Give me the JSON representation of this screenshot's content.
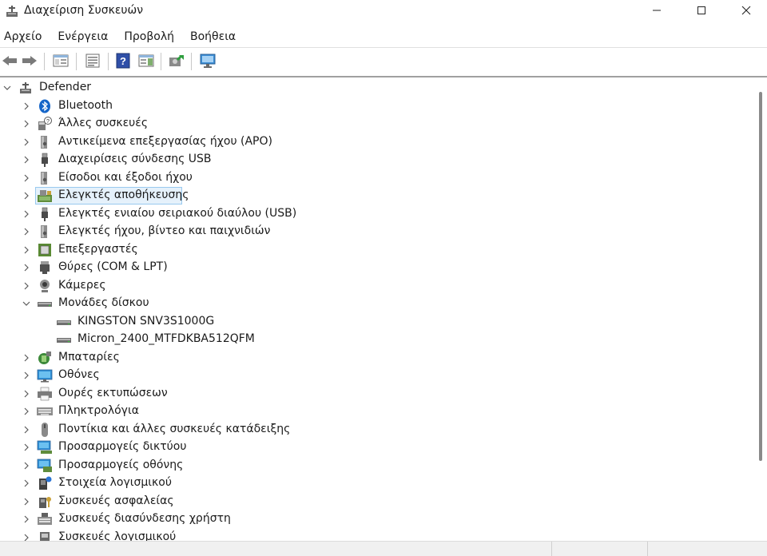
{
  "window": {
    "title": "Διαχείριση Συσκευών",
    "app_icon": "device-manager-icon"
  },
  "menu": [
    {
      "label": "Αρχείο"
    },
    {
      "label": "Ενέργεια"
    },
    {
      "label": "Προβολή"
    },
    {
      "label": "Βοήθεια"
    }
  ],
  "toolbar": {
    "buttons": [
      "back-arrow-icon",
      "forward-arrow-icon",
      "show-hide-console-tree-icon",
      "properties-icon",
      "help-icon",
      "action-pane-icon",
      "update-driver-icon",
      "scan-hardware-icon"
    ]
  },
  "tree": {
    "root": {
      "label": "Defender",
      "icon": "computer-icon",
      "expanded": true
    },
    "items": [
      {
        "label": "Bluetooth",
        "icon": "bluetooth-icon",
        "expanded": false,
        "level": 1
      },
      {
        "label": "Άλλες συσκευές",
        "icon": "unknown-device-icon",
        "expanded": false,
        "level": 1
      },
      {
        "label": "Αντικείμενα επεξεργασίας ήχου (APO)",
        "icon": "speaker-icon",
        "expanded": false,
        "level": 1
      },
      {
        "label": "Διαχειρίσεις σύνδεσης USB",
        "icon": "usb-plug-icon",
        "expanded": false,
        "level": 1
      },
      {
        "label": "Είσοδοι και έξοδοι ήχου",
        "icon": "speaker-icon",
        "expanded": false,
        "level": 1
      },
      {
        "label": "Ελεγκτές αποθήκευσης",
        "icon": "storage-controller-icon",
        "expanded": false,
        "level": 1,
        "selected": true
      },
      {
        "label": "Ελεγκτές ενιαίου σειριακού διαύλου (USB)",
        "icon": "usb-plug-icon",
        "expanded": false,
        "level": 1
      },
      {
        "label": "Ελεγκτές ήχου, βίντεο και παιχνιδιών",
        "icon": "speaker-icon",
        "expanded": false,
        "level": 1
      },
      {
        "label": "Επεξεργαστές",
        "icon": "processor-icon",
        "expanded": false,
        "level": 1
      },
      {
        "label": "Θύρες (COM & LPT)",
        "icon": "port-icon",
        "expanded": false,
        "level": 1
      },
      {
        "label": "Κάμερες",
        "icon": "webcam-icon",
        "expanded": false,
        "level": 1
      },
      {
        "label": "Μονάδες δίσκου",
        "icon": "disk-drive-icon",
        "expanded": true,
        "level": 1
      },
      {
        "label": "KINGSTON SNV3S1000G",
        "icon": "disk-drive-icon",
        "level": 2
      },
      {
        "label": "Micron_2400_MTFDKBA512QFM",
        "icon": "disk-drive-icon",
        "level": 2
      },
      {
        "label": "Μπαταρίες",
        "icon": "battery-icon",
        "expanded": false,
        "level": 1
      },
      {
        "label": "Οθόνες",
        "icon": "monitor-icon",
        "expanded": false,
        "level": 1
      },
      {
        "label": "Ουρές εκτυπώσεων",
        "icon": "printer-icon",
        "expanded": false,
        "level": 1
      },
      {
        "label": "Πληκτρολόγια",
        "icon": "keyboard-icon",
        "expanded": false,
        "level": 1
      },
      {
        "label": "Ποντίκια και άλλες συσκευές κατάδειξης",
        "icon": "mouse-icon",
        "expanded": false,
        "level": 1
      },
      {
        "label": "Προσαρμογείς δικτύου",
        "icon": "network-adapter-icon",
        "expanded": false,
        "level": 1
      },
      {
        "label": "Προσαρμογείς οθόνης",
        "icon": "display-adapter-icon",
        "expanded": false,
        "level": 1
      },
      {
        "label": "Στοιχεία λογισμικού",
        "icon": "software-component-icon",
        "expanded": false,
        "level": 1
      },
      {
        "label": "Συσκευές ασφαλείας",
        "icon": "security-device-icon",
        "expanded": false,
        "level": 1
      },
      {
        "label": "Συσκευές διασύνδεσης χρήστη",
        "icon": "hid-icon",
        "expanded": false,
        "level": 1
      },
      {
        "label": "Συσκευές λογισμικού",
        "icon": "software-device-icon",
        "expanded": false,
        "level": 1
      }
    ]
  },
  "colors": {
    "selection_bg": "#e5f1fb",
    "selection_border": "#99c9ef",
    "accent": "#0a64c8"
  }
}
